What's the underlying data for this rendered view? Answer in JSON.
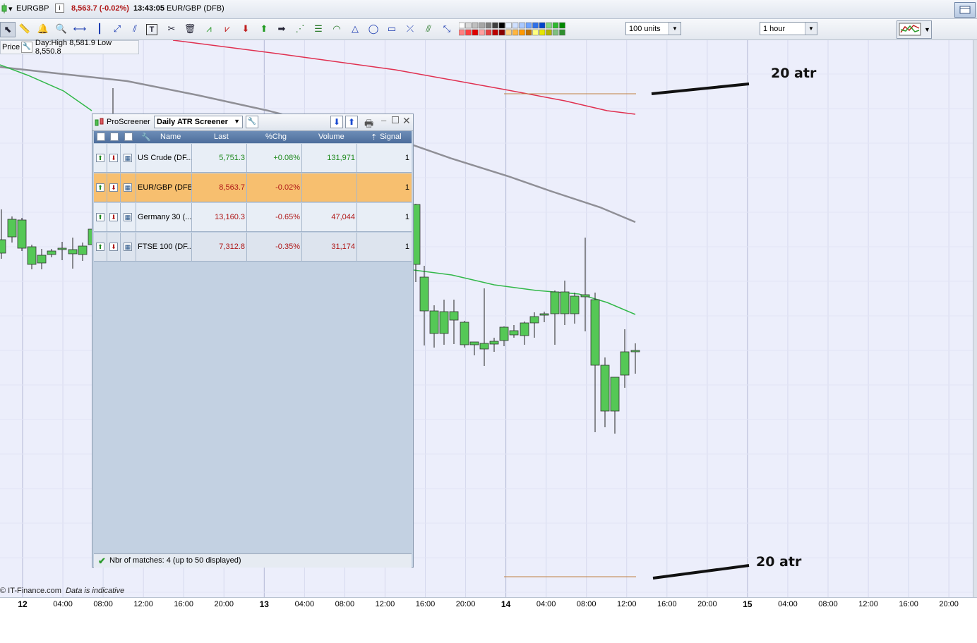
{
  "title_bar": {
    "instrument_code": "EURGBP",
    "price_change": "8,563.7 (-0.02%)",
    "time": "13:43:05",
    "instrument_name": "EUR/GBP (DFB)"
  },
  "toolbar": {
    "units_select": "100 units",
    "timeframe_select": "1 hour"
  },
  "price_bar": {
    "label": "Price",
    "day_info": "Day:High 8,581.9 Low 8,550.8"
  },
  "chart": {
    "colors": {
      "bull": "#55c856",
      "bear": "#dc5c63",
      "ma_red": "#e03050",
      "ma_gray": "#8f8f96",
      "ma_green": "#33b84a",
      "level_line": "#c08040"
    },
    "annotations": {
      "top": "20 atr",
      "bottom": "20 atr"
    },
    "copyright": "© IT-Finance.com",
    "disclaimer": "Data is indicative",
    "x_axis_labels": [
      {
        "text": "12",
        "day": true
      },
      {
        "text": "04:00"
      },
      {
        "text": "08:00"
      },
      {
        "text": "12:00"
      },
      {
        "text": "16:00"
      },
      {
        "text": "20:00"
      },
      {
        "text": "13",
        "day": true
      },
      {
        "text": "04:00"
      },
      {
        "text": "08:00"
      },
      {
        "text": "12:00"
      },
      {
        "text": "16:00"
      },
      {
        "text": "20:00"
      },
      {
        "text": "14",
        "day": true
      },
      {
        "text": "04:00"
      },
      {
        "text": "08:00"
      },
      {
        "text": "12:00"
      },
      {
        "text": "16:00"
      },
      {
        "text": "20:00"
      },
      {
        "text": "15",
        "day": true
      },
      {
        "text": "04:00"
      },
      {
        "text": "08:00"
      },
      {
        "text": "12:00"
      },
      {
        "text": "16:00"
      },
      {
        "text": "20:00"
      }
    ]
  },
  "screener": {
    "title": "ProScreener",
    "selected": "Daily ATR Screener",
    "columns": [
      "Name",
      "Last",
      "%Chg",
      "Volume",
      "Signal"
    ],
    "rows": [
      {
        "name": "US Crude (DF...",
        "last": "5,751.3",
        "chg": "+0.08%",
        "volume": "131,971",
        "signal": "1",
        "dir": "up",
        "highlight": false
      },
      {
        "name": "EUR/GBP (DFB)",
        "last": "8,563.7",
        "chg": "-0.02%",
        "volume": "",
        "signal": "1",
        "dir": "down",
        "highlight": true
      },
      {
        "name": "Germany 30 (...",
        "last": "13,160.3",
        "chg": "-0.65%",
        "volume": "47,044",
        "signal": "1",
        "dir": "down",
        "highlight": false
      },
      {
        "name": "FTSE 100 (DF...",
        "last": "7,312.8",
        "chg": "-0.35%",
        "volume": "31,174",
        "signal": "1",
        "dir": "down",
        "highlight": false
      }
    ],
    "footer": "Nbr of matches: 4 (up to 50 displayed)"
  }
}
